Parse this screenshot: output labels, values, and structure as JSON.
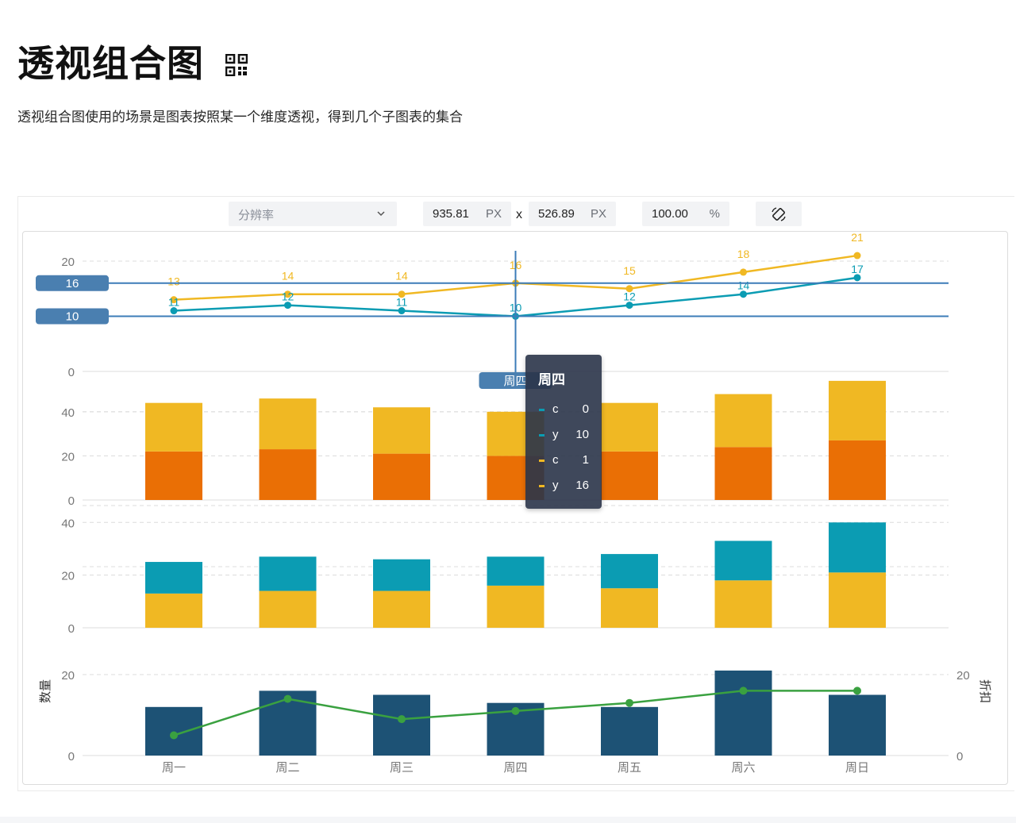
{
  "page": {
    "title": "透视组合图",
    "description": "透视组合图使用的场景是图表按照某一个维度透视，得到几个子图表的集合"
  },
  "toolbar": {
    "resolution_placeholder": "分辨率",
    "width_value": "935.81",
    "width_unit": "PX",
    "times": "x",
    "height_value": "526.89",
    "height_unit": "PX",
    "zoom_value": "100.00",
    "zoom_unit": "%"
  },
  "colors": {
    "teal": "#0b9cb3",
    "yellow": "#f0b823",
    "orange": "#ea6f05",
    "navy": "#1d5275",
    "green": "#3aa140",
    "crosshair": "#3c7cb8",
    "grid": "#dcdcdc",
    "axis_text": "#777777"
  },
  "chart_data": [
    {
      "type": "line",
      "categories": [
        "周一",
        "周二",
        "周三",
        "周四",
        "周五",
        "周六",
        "周日"
      ],
      "ylim": [
        0,
        20
      ],
      "yticks": [
        0,
        20
      ],
      "series": [
        {
          "color": "#f0b823",
          "values": [
            13,
            14,
            14,
            16,
            15,
            18,
            21
          ]
        },
        {
          "color": "#0b9cb3",
          "values": [
            11,
            12,
            11,
            10,
            12,
            14,
            17
          ]
        }
      ],
      "crosshair": {
        "category": "周四",
        "y_labels": [
          "16",
          "10"
        ]
      }
    },
    {
      "type": "bar",
      "stacked": true,
      "categories": [
        "周一",
        "周二",
        "周三",
        "周四",
        "周五",
        "周六",
        "周日"
      ],
      "ylim": [
        0,
        50
      ],
      "yticks": [
        0,
        20,
        40
      ],
      "series": [
        {
          "color": "#ea6f05",
          "values": [
            22,
            23,
            21,
            20,
            22,
            24,
            27
          ]
        },
        {
          "color": "#f0b823",
          "values": [
            22,
            23,
            21,
            20,
            22,
            24,
            27
          ]
        }
      ]
    },
    {
      "type": "bar",
      "stacked": true,
      "categories": [
        "周一",
        "周二",
        "周三",
        "周四",
        "周五",
        "周六",
        "周日"
      ],
      "ylim": [
        0,
        44
      ],
      "yticks": [
        0,
        20,
        40
      ],
      "series": [
        {
          "color": "#f0b823",
          "values": [
            13,
            14,
            14,
            16,
            15,
            18,
            21
          ]
        },
        {
          "color": "#0b9cb3",
          "values": [
            12,
            13,
            12,
            11,
            13,
            15,
            19
          ]
        }
      ]
    },
    {
      "type": "bar",
      "categories": [
        "周一",
        "周二",
        "周三",
        "周四",
        "周五",
        "周六",
        "周日"
      ],
      "ylabel": "数量",
      "ylabel_right": "折扣",
      "ylim": [
        0,
        20
      ],
      "yticks": [
        0,
        20
      ],
      "yticks_right": [
        0,
        20
      ],
      "series": [
        {
          "color": "#1d5275",
          "kind": "bar",
          "values": [
            12,
            16,
            15,
            13,
            12,
            21,
            15
          ]
        },
        {
          "color": "#3aa140",
          "kind": "line",
          "values": [
            5,
            14,
            9,
            11,
            13,
            16,
            16
          ]
        }
      ]
    }
  ],
  "tooltip": {
    "title": "周四",
    "rows": [
      {
        "key": "c",
        "value": "0",
        "color": "#0b9cb3"
      },
      {
        "key": "y",
        "value": "10",
        "color": "#0b9cb3"
      },
      {
        "key": "c",
        "value": "1",
        "color": "#f0b823"
      },
      {
        "key": "y",
        "value": "16",
        "color": "#f0b823"
      }
    ]
  }
}
